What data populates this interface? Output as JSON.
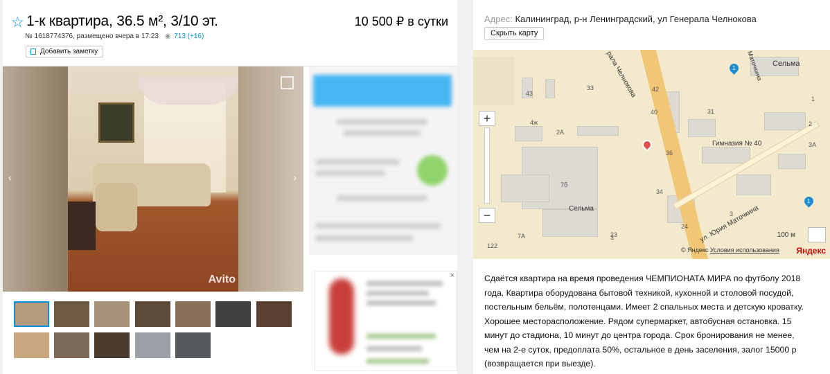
{
  "listing": {
    "title": "1-к квартира, 36.5 м², 3/10 эт.",
    "price": "10 500 ₽ в сутки",
    "meta": "№ 1618774376, размещено вчера в 17:23",
    "views_icon": "eye-icon",
    "views": "713 (+16)",
    "add_note": "Добавить заметку",
    "photo_logo": "Avito",
    "thumbnails_count": 12
  },
  "address": {
    "label": "Адрес:",
    "value": "Калининград, р-н Ленинградский, ул Генерала Челнокова",
    "hide_map": "Скрыть карту"
  },
  "map": {
    "street_main": "рала Челнокова",
    "street_lower": "ул. Юрия Маточкина",
    "street_top": "Маточкина",
    "poi_school": "Гимназия № 40",
    "poi_selma": "Сельма",
    "poi_selma_top": "Сельма",
    "numbers": [
      "43",
      "33",
      "42",
      "40",
      "36",
      "34",
      "24",
      "23",
      "31",
      "3А",
      "1",
      "2А",
      "3",
      "4ж",
      "7б",
      "122",
      "7А",
      "2",
      "3"
    ],
    "pin_label_1": "1",
    "pin_label_2": "1",
    "zoom_in": "+",
    "zoom_out": "−",
    "scale": "100 м",
    "copyright": "© Яндекс",
    "terms": "Условия использования",
    "logo": "Яндекс"
  },
  "description": "Сдаётся квартира на время проведения ЧЕМПИОНАТА МИРА по футболу 2018 года. Квартира оборудована бытовой техникой, кухонной и столовой посудой, постельным бельём, полотенцами. Имеет 2 спальных места и детскую кроватку. Хорошее месторасположение. Рядом супермаркет, автобусная остановка. 15 минут до стадиона, 10 минут до центра города. Срок бронирования не менее, чем на 2-е суток, предоплата 50%, остальное в день заселения, залог 15000 р (возвращается при выезде).",
  "colors": {
    "accent": "#0091d9",
    "map_bg": "#f3e9cc",
    "road": "#f1c675"
  }
}
